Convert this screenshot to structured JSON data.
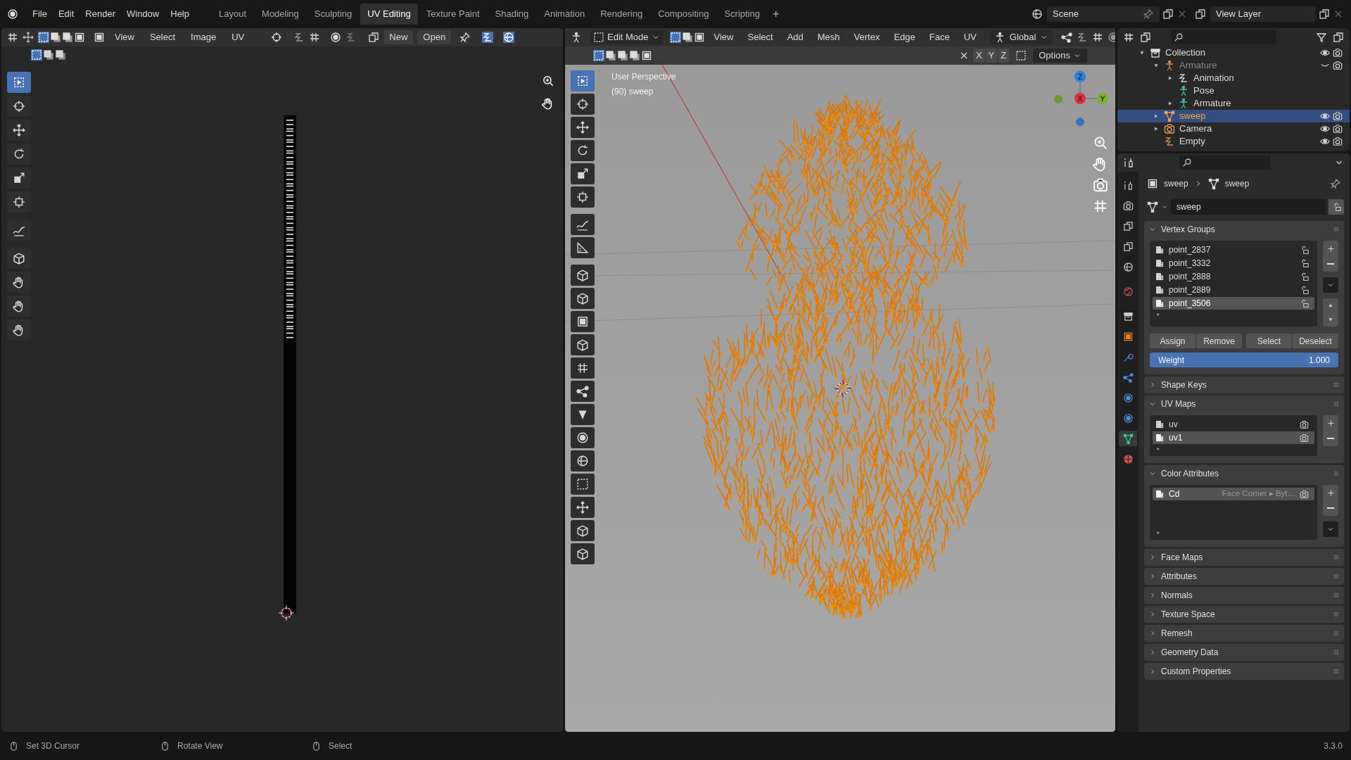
{
  "top_bar": {
    "menus": [
      "File",
      "Edit",
      "Render",
      "Window",
      "Help"
    ],
    "workspaces": [
      {
        "label": "Layout",
        "selected": false
      },
      {
        "label": "Modeling",
        "selected": false
      },
      {
        "label": "Sculpting",
        "selected": false
      },
      {
        "label": "UV Editing",
        "selected": true
      },
      {
        "label": "Texture Paint",
        "selected": false
      },
      {
        "label": "Shading",
        "selected": false
      },
      {
        "label": "Animation",
        "selected": false
      },
      {
        "label": "Rendering",
        "selected": false
      },
      {
        "label": "Compositing",
        "selected": false
      },
      {
        "label": "Scripting",
        "selected": false
      }
    ],
    "add_workspace": "+",
    "scene": "Scene",
    "view_layer": "View Layer"
  },
  "uv_editor": {
    "menus": [
      "View",
      "Select",
      "Image",
      "UV"
    ],
    "new_button": "New",
    "open_button": "Open",
    "tools": [
      {
        "selected": true
      },
      {
        "selected": false
      },
      {
        "selected": false
      },
      {
        "selected": false
      },
      {
        "selected": false
      },
      {
        "selected": false
      },
      {
        "selected": false
      },
      {
        "selected": false
      },
      {
        "selected": false
      },
      {
        "selected": false
      },
      {
        "selected": false
      }
    ]
  },
  "viewport": {
    "mode": "Edit Mode",
    "menus": [
      "View",
      "Select",
      "Add",
      "Mesh",
      "Vertex",
      "Edge",
      "Face",
      "UV"
    ],
    "orientation": "Global",
    "axis_toggles": [
      "X",
      "Y",
      "Z"
    ],
    "options": "Options",
    "overlay_text": [
      "User Perspective",
      "(90) sweep"
    ],
    "gizmo_axes": [
      "Z",
      "X",
      "Y"
    ],
    "tools": [
      {
        "selected": true
      },
      {
        "selected": false
      },
      {
        "selected": false
      },
      {
        "selected": false
      },
      {
        "selected": false
      },
      {
        "selected": false
      },
      {
        "selected": false
      },
      {
        "selected": false
      },
      {
        "selected": false
      },
      {
        "selected": false
      },
      {
        "selected": false
      },
      {
        "selected": false
      },
      {
        "selected": false
      },
      {
        "selected": false
      },
      {
        "selected": false
      },
      {
        "selected": false
      },
      {
        "selected": false
      },
      {
        "selected": false
      },
      {
        "selected": false
      },
      {
        "selected": false
      },
      {
        "selected": false
      }
    ]
  },
  "outliner": {
    "tree": [
      {
        "label": "Collection",
        "selected": false,
        "expanded": true,
        "visible": true,
        "children": [
          {
            "label": "Armature",
            "selected": false,
            "expanded": true,
            "visible": false,
            "children": [
              {
                "label": "Animation",
                "selected": false,
                "expanded": false
              },
              {
                "label": "Pose",
                "selected": false
              },
              {
                "label": "Armature",
                "selected": false,
                "expanded": false
              }
            ]
          },
          {
            "label": "sweep",
            "selected": true,
            "expanded": false,
            "visible": true
          },
          {
            "label": "Camera",
            "selected": false,
            "expanded": false,
            "visible": true
          },
          {
            "label": "Empty",
            "selected": false,
            "visible": true
          }
        ]
      }
    ]
  },
  "properties": {
    "tabs": [
      {
        "selected": false
      },
      {
        "selected": false
      },
      {
        "selected": false
      },
      {
        "selected": false
      },
      {
        "selected": false
      },
      {
        "selected": false
      },
      {
        "selected": false
      },
      {
        "selected": false
      },
      {
        "selected": false
      },
      {
        "selected": false
      },
      {
        "selected": false
      },
      {
        "selected": false
      },
      {
        "selected": true
      },
      {
        "selected": false
      }
    ],
    "breadcrumb": [
      "sweep",
      "sweep"
    ],
    "mesh_name": "sweep",
    "panels": [
      {
        "title": "Vertex Groups",
        "expanded": true,
        "items": [
          {
            "label": "point_2837",
            "selected": false
          },
          {
            "label": "point_3332",
            "selected": false
          },
          {
            "label": "point_2888",
            "selected": false
          },
          {
            "label": "point_2889",
            "selected": false
          },
          {
            "label": "point_3506",
            "selected": true
          }
        ],
        "buttons": [
          "Assign",
          "Remove",
          "Select",
          "Deselect"
        ],
        "weight": {
          "label": "Weight",
          "value": "1.000",
          "level": 1
        }
      },
      {
        "title": "Shape Keys",
        "expanded": false
      },
      {
        "title": "UV Maps",
        "expanded": true,
        "items": [
          {
            "label": "uv",
            "selected": false
          },
          {
            "label": "uv1",
            "selected": true
          }
        ]
      },
      {
        "title": "Color Attributes",
        "expanded": true,
        "items": [
          {
            "label": "Cd",
            "detail": "Face Corner ▸ Byt…",
            "selected": true
          }
        ]
      },
      {
        "title": "Face Maps",
        "expanded": false
      },
      {
        "title": "Attributes",
        "expanded": false
      },
      {
        "title": "Normals",
        "expanded": false
      },
      {
        "title": "Texture Space",
        "expanded": false
      },
      {
        "title": "Remesh",
        "expanded": false
      },
      {
        "title": "Geometry Data",
        "expanded": false
      },
      {
        "title": "Custom Properties",
        "expanded": false
      }
    ]
  },
  "status_bar": {
    "hints": [
      "Set 3D Cursor",
      "Rotate View",
      "Select"
    ],
    "version": "3.3.0"
  }
}
